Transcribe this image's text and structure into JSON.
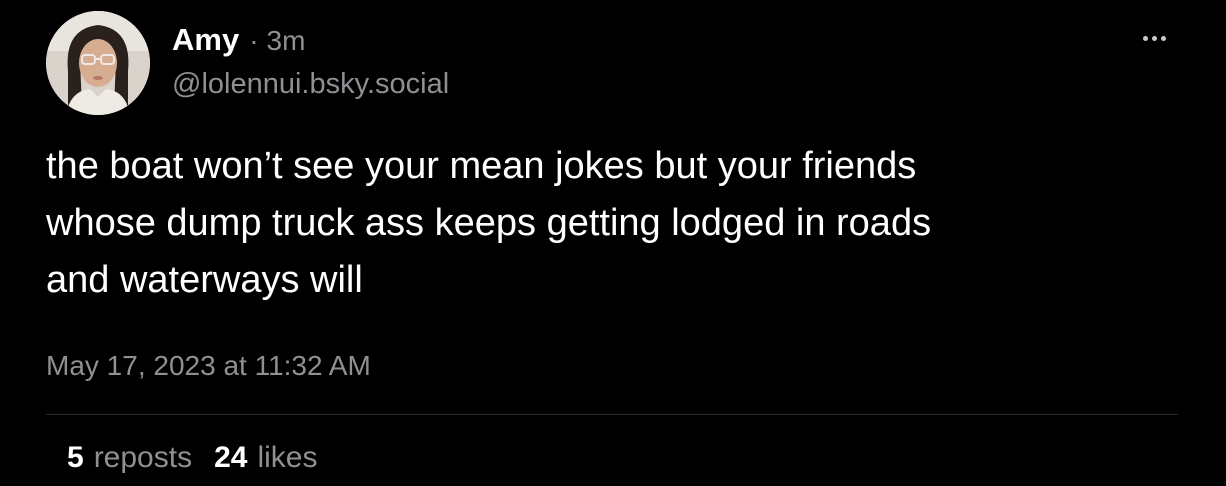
{
  "author": {
    "display_name": "Amy",
    "separator": "·",
    "time_ago": "3m",
    "handle": "@lolennui.bsky.social"
  },
  "post": {
    "lines": [
      "the boat won’t see your mean jokes but your friends",
      "whose dump truck ass keeps getting lodged in roads",
      "and waterways will"
    ],
    "timestamp": "May 17, 2023 at 11:32 AM"
  },
  "stats": {
    "reposts_count": "5",
    "reposts_label": "reposts",
    "likes_count": "24",
    "likes_label": "likes"
  },
  "icons": {
    "more": "more-horizontal-icon"
  },
  "colors": {
    "background": "#000000",
    "text": "#ffffff",
    "muted": "#8f8f94",
    "divider": "#2c2c2e"
  }
}
